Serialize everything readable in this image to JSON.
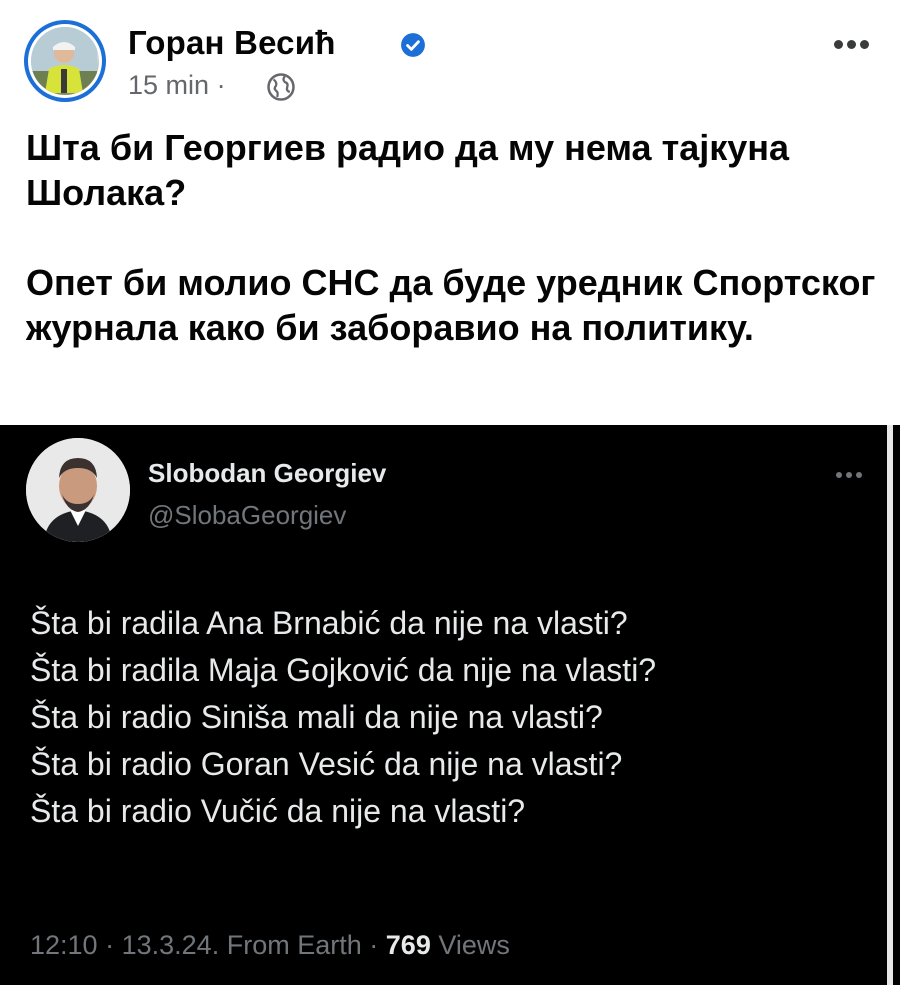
{
  "post": {
    "author_name": "Горан Весић",
    "time": "15 min",
    "separator": "·",
    "verified_icon": "verified-badge-icon",
    "audience_icon": "globe-icon",
    "more_icon": "more-options-icon",
    "paragraphs": [
      "Шта би Георгиев радио да му нема тајкуна Шолака?",
      "Опет би молио СНС да буде уредник Спортског журнала како би заборавио на политику."
    ]
  },
  "tweet": {
    "display_name": "Slobodan Georgiev",
    "handle": "@SlobaGeorgiev",
    "lines": [
      "Šta bi radila Ana Brnabić da nije na vlasti?",
      "Šta bi radila Maja Gojković da nije na vlasti?",
      "Šta bi radio Siniša mali da nije na vlasti?",
      "Šta bi radio Goran Vesić da nije na vlasti?",
      "Šta bi radio Vučić da nije na vlasti?"
    ],
    "footer": {
      "time": "12:10",
      "date": "13.3.24.",
      "source": "From Earth",
      "views_count": "769",
      "views_label": "Views",
      "separator": "·"
    }
  },
  "colors": {
    "fb_blue": "#1b6fd6",
    "tweet_bg": "#000000",
    "tweet_text": "#e7e9ea",
    "tweet_muted": "#71767b"
  }
}
